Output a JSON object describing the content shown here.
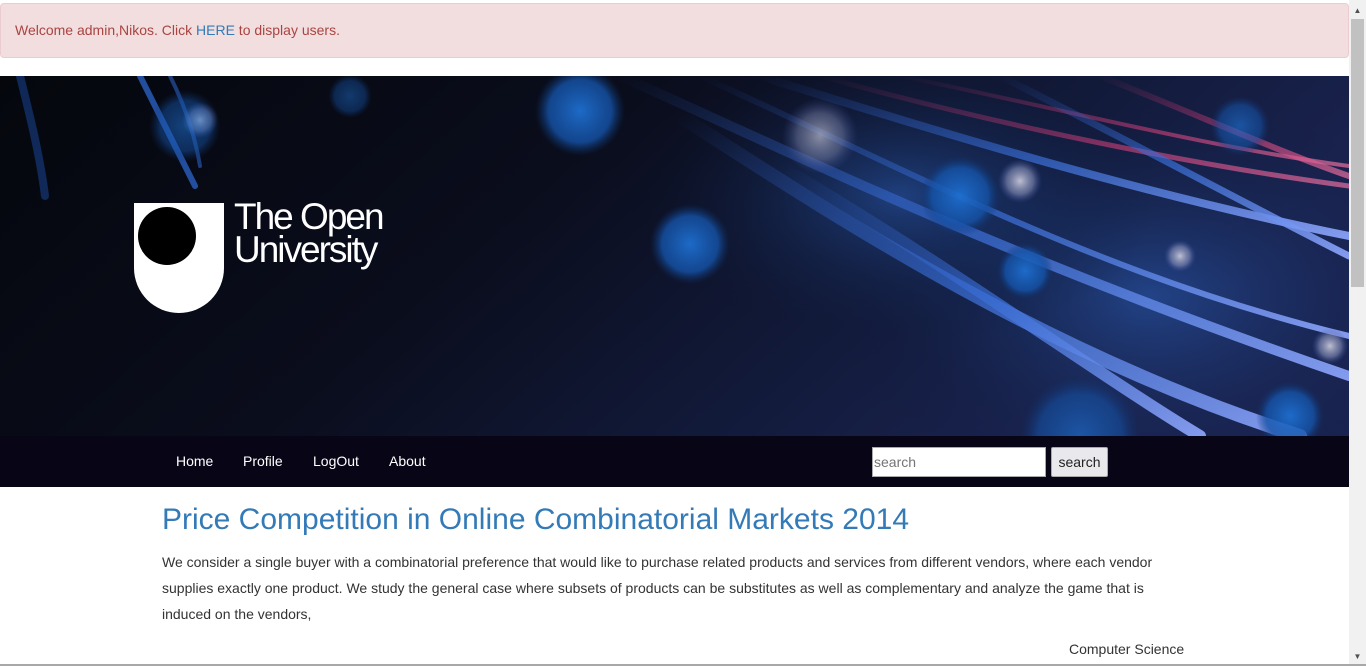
{
  "alert": {
    "prefix": "Welcome admin,Nikos. Click ",
    "link": "HERE",
    "suffix": " to display users."
  },
  "banner": {
    "logo_line1": "The Open",
    "logo_line2": "University",
    "logo_icon": "open-university-shield-icon"
  },
  "nav": {
    "items": [
      "Home",
      "Profile",
      "LogOut",
      "About"
    ]
  },
  "search": {
    "placeholder": "search",
    "button_label": "search"
  },
  "content": {
    "title": "Price Competition in Online Combinatorial Markets 2014",
    "abstract": "We consider a single buyer with a combinatorial preference that would like to purchase related products and services from different vendors, where each vendor supplies exactly one product. We study the general case where subsets of products can be substitutes as well as complementary and analyze the game that is induced on the vendors,",
    "category": "Computer Science"
  },
  "colors": {
    "alert_bg": "#f2dede",
    "alert_text": "#a94442",
    "link": "#337ab7",
    "navbar_bg": "#080616"
  }
}
